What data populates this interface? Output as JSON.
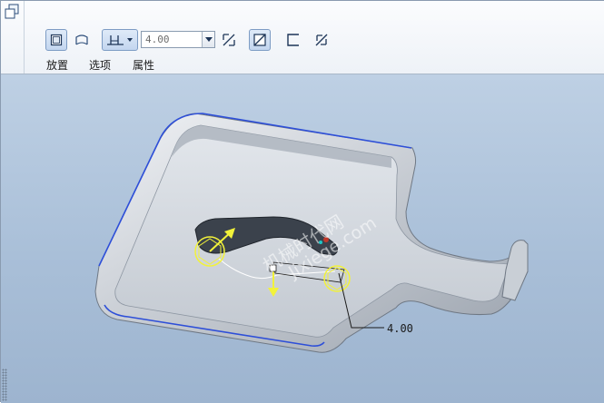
{
  "toolbar": {
    "depth_value": "4.00",
    "tabs": [
      {
        "label": "放置"
      },
      {
        "label": "选项"
      },
      {
        "label": "属性"
      }
    ]
  },
  "viewport": {
    "dimension_label": "4.00",
    "watermark_cn": "机械时代网",
    "watermark_url": "Jixiege.com"
  },
  "colors": {
    "toolbar_bg": "#eef2f7",
    "viewport_bg": "#a9bfd8",
    "part_surface": "#c9cfd6",
    "edge_highlight": "#2e4fd8",
    "handle_yellow": "#f2f23a"
  },
  "icons": [
    "dashboard-icon",
    "solid-cut-icon",
    "surface-icon",
    "blind-depth-icon",
    "dropdown-arrow-icon",
    "flip-direction-icon",
    "remove-material-icon",
    "thicken-icon",
    "flip-thicken-icon"
  ]
}
